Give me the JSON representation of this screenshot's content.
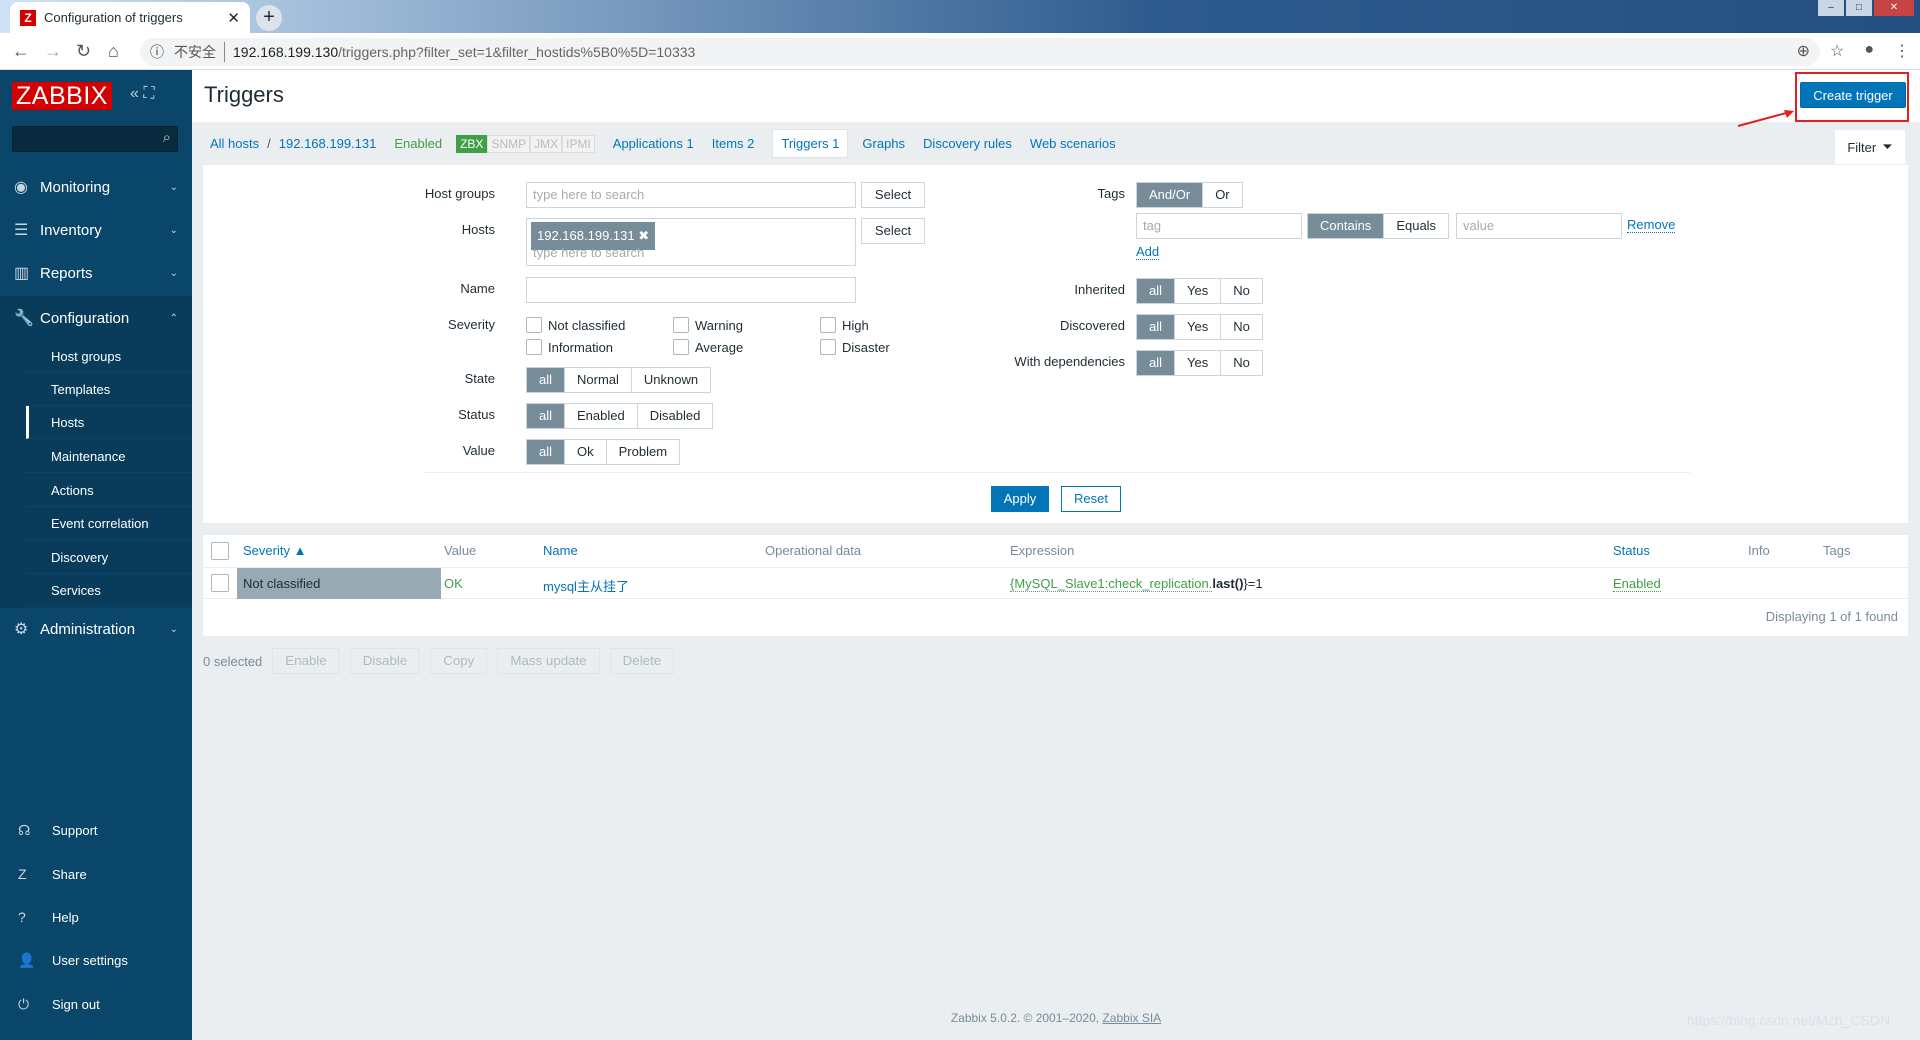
{
  "browser": {
    "tab_title": "Configuration of triggers",
    "insecure": "不安全",
    "url_host": "192.168.199.130",
    "url_path": "/triggers.php?filter_set=1&filter_hostids%5B0%5D=10333"
  },
  "sidebar": {
    "logo": "ZABBIX",
    "menu": [
      {
        "label": "Monitoring",
        "icon": "eye-icon"
      },
      {
        "label": "Inventory",
        "icon": "list-icon"
      },
      {
        "label": "Reports",
        "icon": "bar-chart-icon"
      },
      {
        "label": "Configuration",
        "icon": "wrench-icon"
      }
    ],
    "submenu": [
      "Host groups",
      "Templates",
      "Hosts",
      "Maintenance",
      "Actions",
      "Event correlation",
      "Discovery",
      "Services"
    ],
    "admin": "Administration",
    "bottom": [
      {
        "label": "Support",
        "icon": "headset-icon"
      },
      {
        "label": "Share",
        "icon": "share-icon"
      },
      {
        "label": "Help",
        "icon": "help-icon"
      },
      {
        "label": "User settings",
        "icon": "user-icon"
      },
      {
        "label": "Sign out",
        "icon": "power-icon"
      }
    ]
  },
  "header": {
    "title": "Triggers",
    "create": "Create trigger"
  },
  "subnav": {
    "all_hosts": "All hosts",
    "host": "192.168.199.131",
    "status": "Enabled",
    "badges": [
      "ZBX",
      "SNMP",
      "JMX",
      "IPMI"
    ],
    "applications": "Applications 1",
    "items": "Items 2",
    "triggers": "Triggers 1",
    "graphs": "Graphs",
    "discovery": "Discovery rules",
    "web": "Web scenarios",
    "filter": "Filter"
  },
  "filter": {
    "host_groups": "Host groups",
    "hosts": "Hosts",
    "name": "Name",
    "severity": "Severity",
    "state": "State",
    "status": "Status",
    "value": "Value",
    "placeholder": "type here to search",
    "select": "Select",
    "host_tag": "192.168.199.131",
    "severities": [
      "Not classified",
      "Warning",
      "High",
      "Information",
      "Average",
      "Disaster"
    ],
    "state_opts": [
      "all",
      "Normal",
      "Unknown"
    ],
    "status_opts": [
      "all",
      "Enabled",
      "Disabled"
    ],
    "value_opts": [
      "all",
      "Ok",
      "Problem"
    ],
    "tags": "Tags",
    "tag_ops": [
      "And/Or",
      "Or"
    ],
    "tag_placeholder": "tag",
    "match_ops": [
      "Contains",
      "Equals"
    ],
    "value_placeholder": "value",
    "remove": "Remove",
    "add": "Add",
    "inherited": "Inherited",
    "discovered": "Discovered",
    "with_deps": "With dependencies",
    "yn": [
      "all",
      "Yes",
      "No"
    ],
    "apply": "Apply",
    "reset": "Reset"
  },
  "table": {
    "headers": {
      "severity": "Severity ▲",
      "value": "Value",
      "name": "Name",
      "opdata": "Operational data",
      "expression": "Expression",
      "status": "Status",
      "info": "Info",
      "tags": "Tags"
    },
    "rows": [
      {
        "severity": "Not classified",
        "value": "OK",
        "name": "mysql主从挂了",
        "expr_host": "{MySQL_Slave1:check_replication.",
        "expr_fn": "last()",
        "expr_end": "}=1",
        "status": "Enabled"
      }
    ],
    "displaying": "Displaying 1 of 1 found"
  },
  "actions": {
    "selected": "0 selected",
    "buttons": [
      "Enable",
      "Disable",
      "Copy",
      "Mass update",
      "Delete"
    ]
  },
  "footer": {
    "text": "Zabbix 5.0.2. © 2001–2020,",
    "link": "Zabbix SIA"
  },
  "watermark": "https://blog.csdn.net/Mzh_CSDN"
}
